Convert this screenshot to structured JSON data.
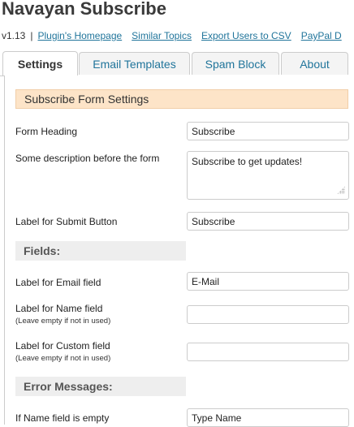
{
  "header": {
    "title": "Navayan Subscribe",
    "version": "v1.13",
    "separator": "|",
    "links": [
      "Plugin's Homepage",
      "Similar Topics",
      "Export Users to CSV",
      "PayPal D"
    ]
  },
  "tabs": [
    {
      "label": "Settings",
      "active": true
    },
    {
      "label": "Email Templates",
      "active": false
    },
    {
      "label": "Spam Block",
      "active": false
    },
    {
      "label": "About",
      "active": false
    }
  ],
  "section_title": "Subscribe Form Settings",
  "form": {
    "heading_label": "Form Heading",
    "heading_value": "Subscribe",
    "description_label": "Some description before the form",
    "description_value": "Subscribe to get updates!",
    "submit_label": "Label for Submit Button",
    "submit_value": "Subscribe"
  },
  "fields": {
    "title": "Fields:",
    "email_label": "Label for Email field",
    "email_value": "E-Mail",
    "name_label": "Label for Name field",
    "name_hint": "(Leave empty if not in used)",
    "name_value": "",
    "custom_label": "Label for Custom field",
    "custom_hint": "(Leave empty if not in used)",
    "custom_value": ""
  },
  "errors": {
    "title": "Error Messages:",
    "name_empty_label": "If Name field is empty",
    "name_empty_value": "Type Name"
  },
  "colors": {
    "link": "#21759b",
    "section_bg": "#fde4c8",
    "subhead_bg": "#eeeeee"
  }
}
